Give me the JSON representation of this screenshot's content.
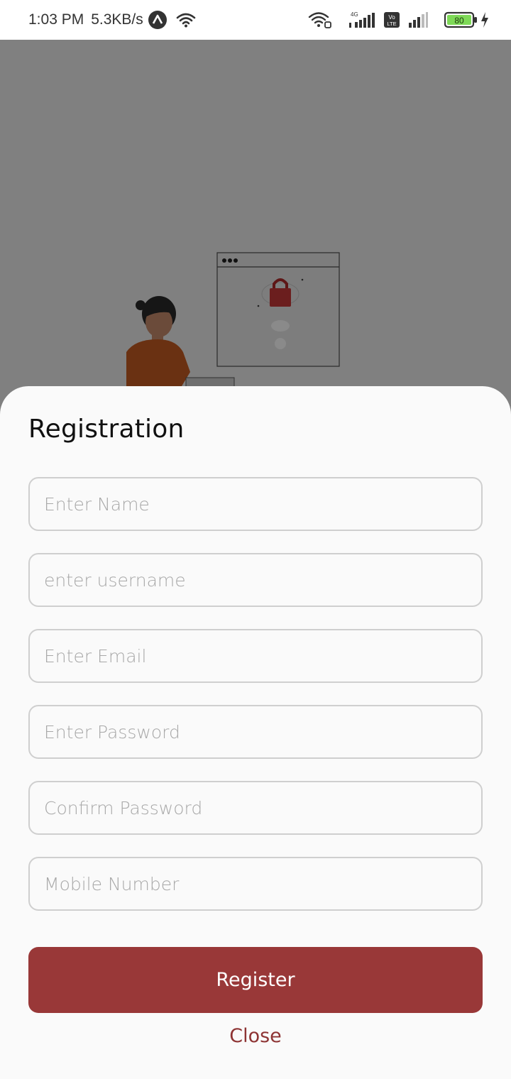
{
  "status_bar": {
    "time": "1:03 PM",
    "speed": "5.3KB/s",
    "battery": "80",
    "network_label": "4G",
    "volte_label": "Vo LTE",
    "icons": [
      "app-a-icon",
      "wifi-icon",
      "wifi-calling-icon",
      "signal-4g-icon",
      "volte-icon",
      "signal-icon",
      "battery-icon",
      "charging-icon"
    ]
  },
  "sheet": {
    "title": "Registration",
    "fields": [
      {
        "placeholder": "Enter Name",
        "value": ""
      },
      {
        "placeholder": "enter username",
        "value": ""
      },
      {
        "placeholder": "Enter Email",
        "value": ""
      },
      {
        "placeholder": "Enter Password",
        "value": ""
      },
      {
        "placeholder": "Confirm Password",
        "value": ""
      },
      {
        "placeholder": "Mobile Number",
        "value": ""
      }
    ],
    "register_label": "Register",
    "close_label": "Close"
  },
  "colors": {
    "accent": "#993838",
    "close_text": "#8e3434",
    "scrim": "#808080",
    "sheet_bg": "#fafafa"
  }
}
